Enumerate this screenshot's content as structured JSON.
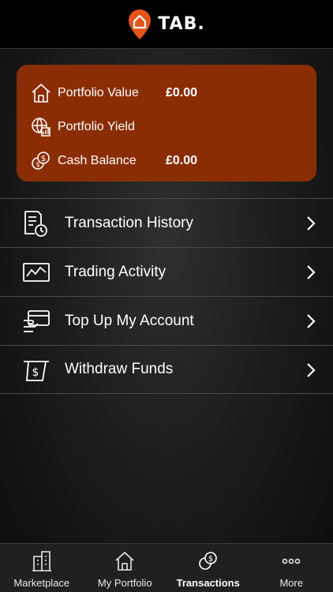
{
  "header": {
    "brand": "TAB.",
    "logo_icon": "location-pin-house-icon",
    "accent": "#e4541b"
  },
  "summary_card": {
    "background": "#8a2d05",
    "rows": [
      {
        "icon": "house-icon",
        "label": "Portfolio Value",
        "value": "£0.00"
      },
      {
        "icon": "yield-globe-icon",
        "label": "Portfolio Yield",
        "value": ""
      },
      {
        "icon": "coins-icon",
        "label": "Cash Balance",
        "value": "£0.00"
      }
    ]
  },
  "menu": {
    "items": [
      {
        "icon": "document-clock-icon",
        "label": "Transaction History"
      },
      {
        "icon": "chart-line-icon",
        "label": "Trading Activity"
      },
      {
        "icon": "card-hand-icon",
        "label": "Top Up My Account"
      },
      {
        "icon": "cash-withdraw-icon",
        "label": "Withdraw Funds"
      }
    ]
  },
  "tabbar": {
    "active": "Transactions",
    "items": [
      {
        "icon": "building-icon",
        "label": "Marketplace"
      },
      {
        "icon": "house-icon",
        "label": "My Portfolio"
      },
      {
        "icon": "coins-icon",
        "label": "Transactions"
      },
      {
        "icon": "more-dots-icon",
        "label": "More"
      }
    ]
  }
}
